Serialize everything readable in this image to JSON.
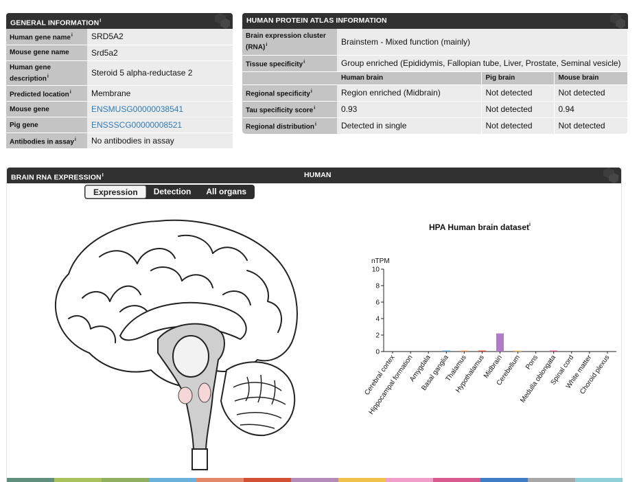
{
  "general": {
    "title": "GENERAL INFORMATION",
    "rows": [
      {
        "key": "Human gene name",
        "sup": "i",
        "value": "SRD5A2"
      },
      {
        "key": "Mouse gene name",
        "sup": "",
        "value": "Srd5a2"
      },
      {
        "key": "Human gene description",
        "sup": "i",
        "value": "Steroid 5 alpha-reductase 2"
      },
      {
        "key": "Predicted location",
        "sup": "i",
        "value": "Membrane"
      },
      {
        "key": "Mouse gene",
        "sup": "",
        "value": "ENSMUSG00000038541"
      },
      {
        "key": "Pig gene",
        "sup": "",
        "value": "ENSSSCG00000008521"
      },
      {
        "key": "Antibodies in assay",
        "sup": "i",
        "value": "No antibodies in assay"
      }
    ]
  },
  "hpa": {
    "title": "HUMAN PROTEIN ATLAS INFORMATION",
    "cluster_key": "Brain expression cluster (RNA)",
    "cluster_value": "Brainstem - Mixed function (mainly)",
    "tissue_key": "Tissue specificity",
    "tissue_value": "Group enriched (Epididymis, Fallopian tube, Liver, Prostate, Seminal vesicle)",
    "subheaders": [
      "Human brain",
      "Pig brain",
      "Mouse brain"
    ],
    "regional_key": "Regional specificity",
    "regional": [
      "Region enriched (Midbrain)",
      "Not detected",
      "Not detected"
    ],
    "tau_key": "Tau specificity score",
    "tau": [
      "0.93",
      "Not detected",
      "0.94"
    ],
    "dist_key": "Regional distribution",
    "dist": [
      "Detected in single",
      "Not detected",
      "Not detected"
    ],
    "sup": "i"
  },
  "brain": {
    "title": "BRAIN RNA EXPRESSION",
    "sup": "i",
    "species": "HUMAN",
    "tabs": [
      "Expression",
      "Detection",
      "All organs"
    ]
  },
  "colors": {
    "header": "#313131",
    "key_bg": "#c4c4c4",
    "value_bg": "#ececec",
    "link": "#2f7ab8",
    "midbrain": "#b07cc6"
  },
  "chart_data": {
    "type": "bar",
    "title": "HPA Human brain dataset",
    "title_sup": "i",
    "ylabel": "nTPM",
    "ylim": [
      0,
      10
    ],
    "yticks": [
      0,
      2,
      4,
      6,
      8,
      10
    ],
    "categories": [
      "Cerebral cortex",
      "Hippocampal formation",
      "Amygdala",
      "Basal ganglia",
      "Thalamus",
      "Hypothalamus",
      "Midbrain",
      "Cerebellum",
      "Pons",
      "Medulla oblongata",
      "Spinal cord",
      "White matter",
      "Choroid plexus"
    ],
    "values": [
      0,
      0,
      0,
      0.1,
      0.1,
      0.1,
      2.2,
      0.05,
      0,
      0.1,
      0,
      0,
      0
    ],
    "bar_colors": [
      "#5da2c9",
      "#9fc26e",
      "#8fb05a",
      "#5da2c9",
      "#e69b6c",
      "#d24b3a",
      "#b07cc6",
      "#e6c46c",
      "#e6a0c6",
      "#c85b8a",
      "#7a9ed8",
      "#bdbdbd",
      "#9ad0d8"
    ]
  },
  "colorbar": [
    "#5e8f7c",
    "#a9c25b",
    "#8faf5f",
    "#6ab2dc",
    "#e4886a",
    "#d45035",
    "#b48ab8",
    "#f0c24a",
    "#f0a0c8",
    "#d85b8e",
    "#3f7dc4",
    "#a7a7a7",
    "#8fd0d8"
  ]
}
